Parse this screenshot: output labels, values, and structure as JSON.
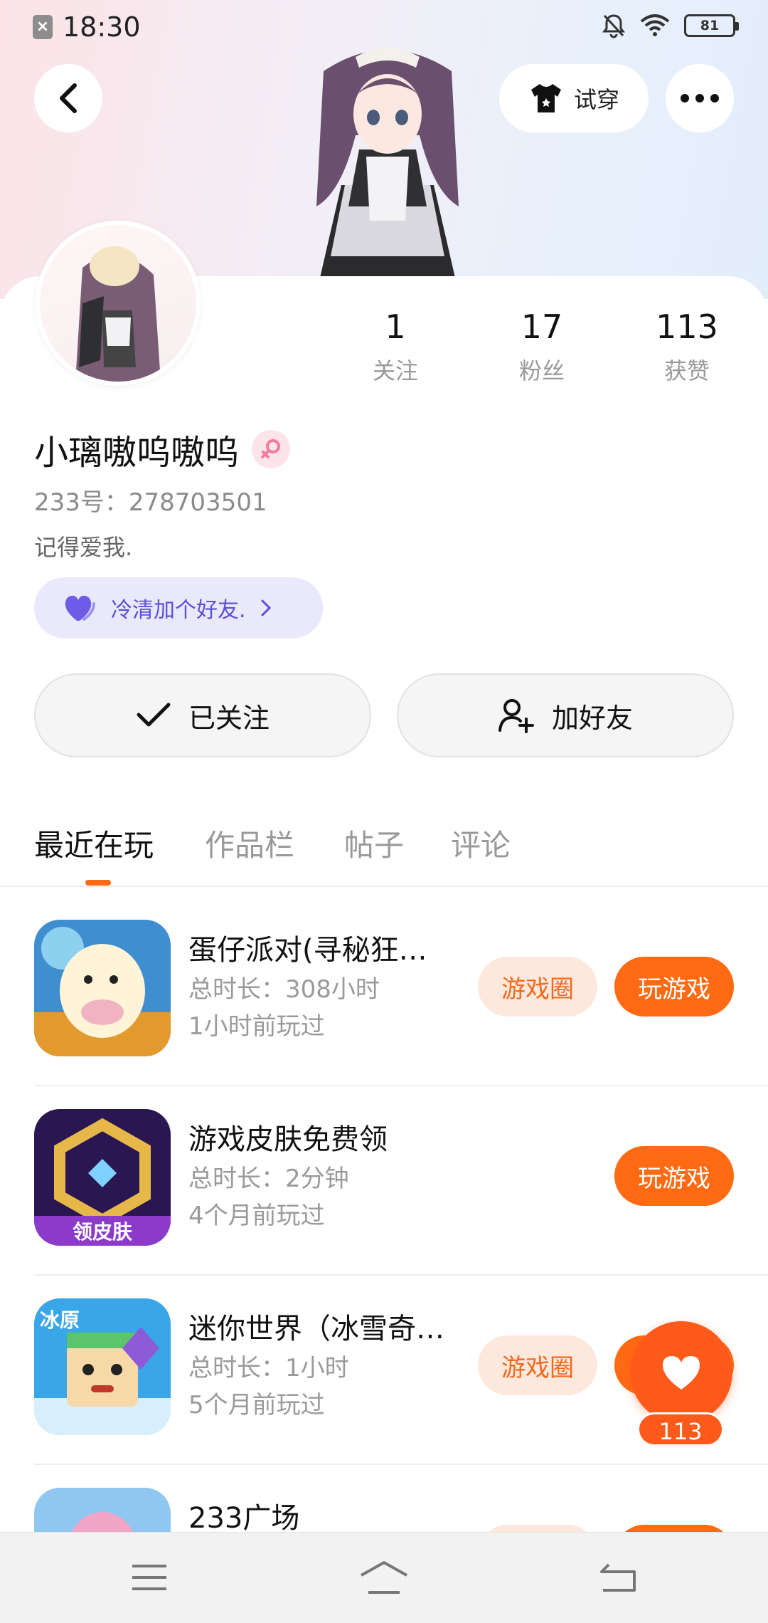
{
  "status_bar": {
    "time": "18:30",
    "battery": "81"
  },
  "header": {
    "try_on_label": "试穿"
  },
  "profile": {
    "stats": [
      {
        "value": "1",
        "label": "关注"
      },
      {
        "value": "17",
        "label": "粉丝"
      },
      {
        "value": "113",
        "label": "获赞"
      }
    ],
    "username": "小璃嗷呜嗷呜",
    "user_id": "233号：278703501",
    "signature": "记得爱我.",
    "friend_pill": "冷清加个好友.",
    "follow_label": "已关注",
    "add_friend_label": "加好友"
  },
  "tabs": [
    {
      "label": "最近在玩",
      "active": true
    },
    {
      "label": "作品栏",
      "active": false
    },
    {
      "label": "帖子",
      "active": false
    },
    {
      "label": "评论",
      "active": false
    }
  ],
  "games": [
    {
      "title": "蛋仔派对(寻秘狂…",
      "duration": "总时长：308小时",
      "last_played": "1小时前玩过",
      "circle_label": "游戏圈",
      "play_label": "玩游戏"
    },
    {
      "title": "游戏皮肤免费领",
      "duration": "总时长：2分钟",
      "last_played": "4个月前玩过",
      "play_label": "玩游戏",
      "icon_text": "领皮肤"
    },
    {
      "title": "迷你世界（冰雪奇…",
      "duration": "总时长：1小时",
      "last_played": "5个月前玩过",
      "circle_label": "游戏圈",
      "play_label": "玩游戏",
      "icon_text": "冰原"
    },
    {
      "title": "233广场"
    }
  ],
  "like_fab": {
    "count": "113"
  },
  "colors": {
    "accent": "#ff6a13",
    "purple": "#5a4fd8"
  }
}
